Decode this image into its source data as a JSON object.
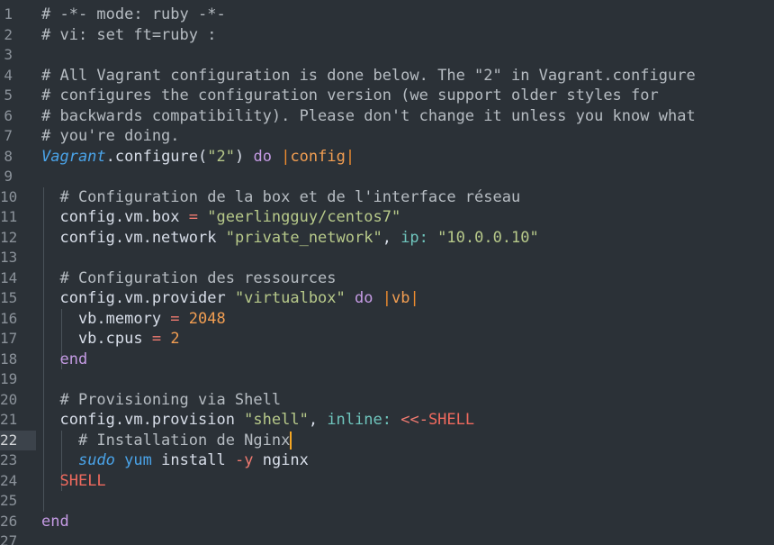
{
  "editor": {
    "language": "ruby",
    "current_line": 22,
    "lines": [
      {
        "num": "1",
        "tokens": [
          {
            "t": "# -*- mode: ruby -*-",
            "c": "comment"
          }
        ]
      },
      {
        "num": "2",
        "tokens": [
          {
            "t": "# vi: set ft=ruby :",
            "c": "comment"
          }
        ]
      },
      {
        "num": "3",
        "tokens": []
      },
      {
        "num": "4",
        "tokens": [
          {
            "t": "# All Vagrant configuration is done below. The \"2\" in Vagrant.configure",
            "c": "comment"
          }
        ]
      },
      {
        "num": "5",
        "tokens": [
          {
            "t": "# configures the configuration version (we support older styles for",
            "c": "comment"
          }
        ]
      },
      {
        "num": "6",
        "tokens": [
          {
            "t": "# backwards compatibility). Please don't change it unless you know what",
            "c": "comment"
          }
        ]
      },
      {
        "num": "7",
        "tokens": [
          {
            "t": "# you're doing.",
            "c": "comment"
          }
        ]
      },
      {
        "num": "8",
        "tokens": [
          {
            "t": "Vagrant",
            "c": "class-name"
          },
          {
            "t": ".configure(",
            "c": "plain"
          },
          {
            "t": "\"2\"",
            "c": "string"
          },
          {
            "t": ") ",
            "c": "plain"
          },
          {
            "t": "do",
            "c": "keyword"
          },
          {
            "t": " ",
            "c": "plain"
          },
          {
            "t": "|",
            "c": "pipe"
          },
          {
            "t": "config",
            "c": "param"
          },
          {
            "t": "|",
            "c": "pipe"
          }
        ]
      },
      {
        "num": "9",
        "tokens": []
      },
      {
        "num": "10",
        "tokens": [
          {
            "t": "  # Configuration de la box et de l'interface réseau",
            "c": "comment"
          }
        ]
      },
      {
        "num": "11",
        "tokens": [
          {
            "t": "  config.vm.box ",
            "c": "plain"
          },
          {
            "t": "=",
            "c": "operator"
          },
          {
            "t": " ",
            "c": "plain"
          },
          {
            "t": "\"geerlingguy/centos7\"",
            "c": "string"
          }
        ]
      },
      {
        "num": "12",
        "tokens": [
          {
            "t": "  config.vm.network ",
            "c": "plain"
          },
          {
            "t": "\"private_network\"",
            "c": "string"
          },
          {
            "t": ", ",
            "c": "plain"
          },
          {
            "t": "ip:",
            "c": "symbol"
          },
          {
            "t": " ",
            "c": "plain"
          },
          {
            "t": "\"10.0.0.10\"",
            "c": "string"
          }
        ]
      },
      {
        "num": "13",
        "tokens": []
      },
      {
        "num": "14",
        "tokens": [
          {
            "t": "  # Configuration des ressources",
            "c": "comment"
          }
        ]
      },
      {
        "num": "15",
        "tokens": [
          {
            "t": "  config.vm.provider ",
            "c": "plain"
          },
          {
            "t": "\"virtualbox\"",
            "c": "string"
          },
          {
            "t": " ",
            "c": "plain"
          },
          {
            "t": "do",
            "c": "keyword"
          },
          {
            "t": " ",
            "c": "plain"
          },
          {
            "t": "|",
            "c": "pipe"
          },
          {
            "t": "vb",
            "c": "param"
          },
          {
            "t": "|",
            "c": "pipe"
          }
        ]
      },
      {
        "num": "16",
        "tokens": [
          {
            "t": "    vb.memory ",
            "c": "plain"
          },
          {
            "t": "=",
            "c": "operator"
          },
          {
            "t": " ",
            "c": "plain"
          },
          {
            "t": "2048",
            "c": "number"
          }
        ]
      },
      {
        "num": "17",
        "tokens": [
          {
            "t": "    vb.cpus ",
            "c": "plain"
          },
          {
            "t": "=",
            "c": "operator"
          },
          {
            "t": " ",
            "c": "plain"
          },
          {
            "t": "2",
            "c": "number"
          }
        ]
      },
      {
        "num": "18",
        "tokens": [
          {
            "t": "  ",
            "c": "plain"
          },
          {
            "t": "end",
            "c": "keyword"
          }
        ]
      },
      {
        "num": "19",
        "tokens": []
      },
      {
        "num": "20",
        "tokens": [
          {
            "t": "  # Provisioning via Shell",
            "c": "comment"
          }
        ]
      },
      {
        "num": "21",
        "tokens": [
          {
            "t": "  config.vm.provision ",
            "c": "plain"
          },
          {
            "t": "\"shell\"",
            "c": "string"
          },
          {
            "t": ", ",
            "c": "plain"
          },
          {
            "t": "inline:",
            "c": "symbol"
          },
          {
            "t": " ",
            "c": "plain"
          },
          {
            "t": "<<-",
            "c": "operator"
          },
          {
            "t": "SHELL",
            "c": "heredoc"
          }
        ]
      },
      {
        "num": "22",
        "tokens": [
          {
            "t": "    # Installation de Nginx",
            "c": "comment"
          }
        ],
        "cursor": true
      },
      {
        "num": "23",
        "tokens": [
          {
            "t": "    ",
            "c": "plain"
          },
          {
            "t": "sudo",
            "c": "italic-blue"
          },
          {
            "t": " ",
            "c": "plain"
          },
          {
            "t": "yum",
            "c": "class-name-plain"
          },
          {
            "t": " install ",
            "c": "plain"
          },
          {
            "t": "-y",
            "c": "operator"
          },
          {
            "t": " nginx",
            "c": "plain"
          }
        ]
      },
      {
        "num": "24",
        "tokens": [
          {
            "t": "  ",
            "c": "plain"
          },
          {
            "t": "SHELL",
            "c": "heredoc"
          }
        ]
      },
      {
        "num": "25",
        "tokens": []
      },
      {
        "num": "26",
        "tokens": [
          {
            "t": "end",
            "c": "keyword"
          }
        ]
      },
      {
        "num": "27",
        "tokens": []
      }
    ]
  },
  "colors": {
    "background": "#2b3137",
    "current_line_gutter": "#3c434b",
    "cursor": "#f5a623"
  }
}
